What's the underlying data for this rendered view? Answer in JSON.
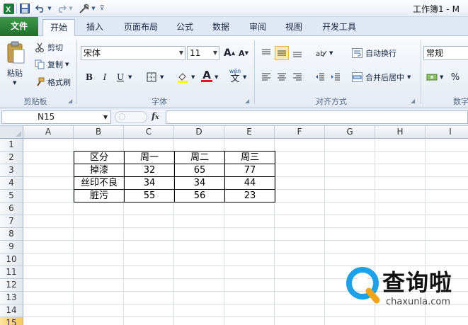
{
  "window": {
    "title": "工作簿1 - M"
  },
  "tabs": [
    "文件",
    "开始",
    "插入",
    "页面布局",
    "公式",
    "数据",
    "审阅",
    "视图",
    "开发工具"
  ],
  "ribbon": {
    "clipboard": {
      "paste": "粘贴",
      "cut": "剪切",
      "copy": "复制",
      "format_painter": "格式刷",
      "label": "剪贴板"
    },
    "font": {
      "name": "宋体",
      "size": "11",
      "grow": "A",
      "shrink": "A",
      "bold": "B",
      "italic": "I",
      "underline": "U",
      "font_color_letter": "A",
      "phonetic": "wén",
      "label": "字体"
    },
    "alignment": {
      "wrap_text": "自动换行",
      "merge_center": "合并后居中",
      "label": "对齐方式"
    },
    "number": {
      "format": "常规",
      "percent": "%",
      "label": "数字"
    }
  },
  "formula_bar": {
    "name_box": "N15",
    "fx": "fx",
    "content": ""
  },
  "columns": [
    "A",
    "B",
    "C",
    "D",
    "E",
    "F",
    "G",
    "H",
    "I"
  ],
  "rows": [
    "1",
    "2",
    "3",
    "4",
    "5",
    "6",
    "7",
    "8",
    "9",
    "10",
    "11",
    "12",
    "13",
    "14",
    "15"
  ],
  "table": {
    "header": [
      "区分",
      "周一",
      "周二",
      "周三"
    ],
    "rows": [
      [
        "掉漆",
        "32",
        "65",
        "77"
      ],
      [
        "丝印不良",
        "34",
        "34",
        "44"
      ],
      [
        "脏污",
        "55",
        "56",
        "23"
      ]
    ]
  },
  "watermark": {
    "text": "查询啦",
    "url": "chaxunla.com"
  },
  "colors": {
    "file_tab": "#2a7f36",
    "selected_align": "#fde9a8",
    "grid_line": "#d9dde3"
  }
}
